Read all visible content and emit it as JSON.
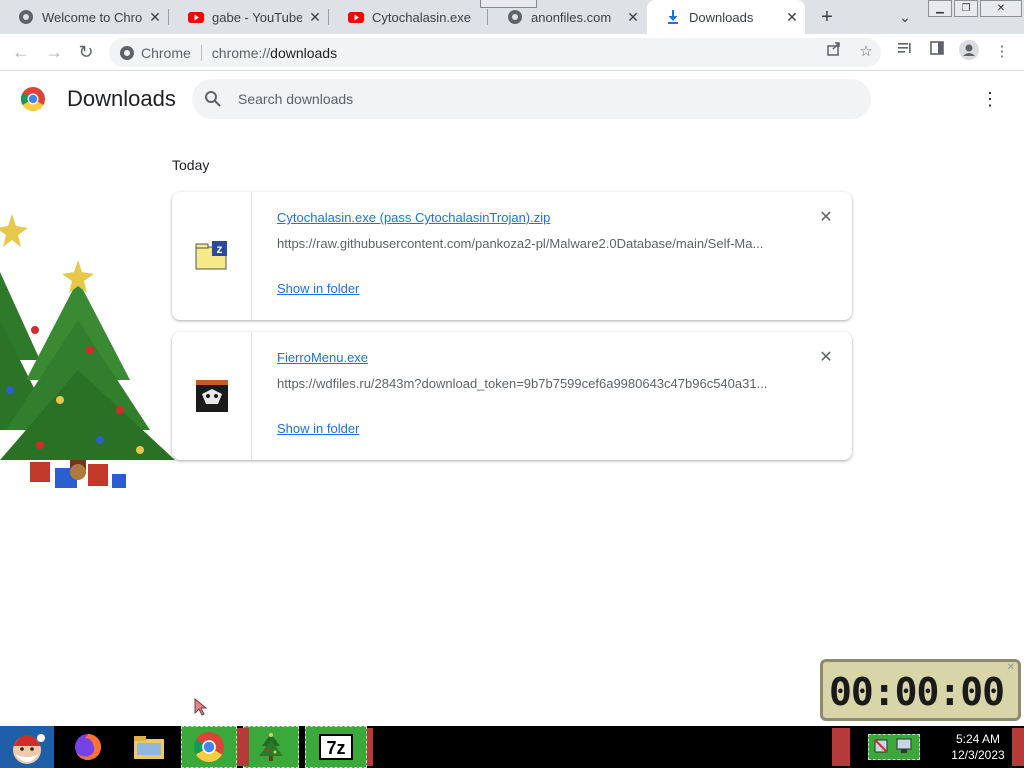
{
  "browser": {
    "tabs": [
      {
        "title": "Welcome to Chrome",
        "icon": "globe-icon"
      },
      {
        "title": "gabe - YouTube",
        "icon": "youtube-icon"
      },
      {
        "title": "Cytochalasin.exe",
        "icon": "youtube-icon"
      },
      {
        "title": "anonfiles.com",
        "icon": "globe-icon"
      },
      {
        "title": "Downloads",
        "icon": "download-icon",
        "active": true
      }
    ],
    "omnibox": {
      "scheme_label": "Chrome",
      "url_prefix": "chrome://",
      "url_path": "downloads"
    }
  },
  "downloads": {
    "title": "Downloads",
    "search_placeholder": "Search downloads",
    "section": "Today",
    "items": [
      {
        "filename": "Cytochalasin.exe (pass CytochalasinTrojan).zip",
        "url": "https://raw.githubusercontent.com/pankoza2-pl/Malware2.0Database/main/Self-Ma...",
        "action": "Show in folder",
        "icon": "zip-archive-icon"
      },
      {
        "filename": "FierroMenu.exe",
        "url": "https://wdfiles.ru/2843m?download_token=9b7b7599cef6a9980643c47b96c540a31...",
        "action": "Show in folder",
        "icon": "exe-app-icon"
      }
    ]
  },
  "timer": {
    "display": "00:00:00"
  },
  "taskbar": {
    "time": "5:24 AM",
    "date": "12/3/2023",
    "apps": [
      "santa-start-icon",
      "firefox-icon",
      "file-explorer-icon",
      "chrome-icon",
      "christmas-tree-icon",
      "7zip-icon"
    ]
  },
  "colors": {
    "accent": "#1a73e8",
    "tab_strip": "#dee1e6",
    "taskbar_active": "#3aa83a"
  }
}
